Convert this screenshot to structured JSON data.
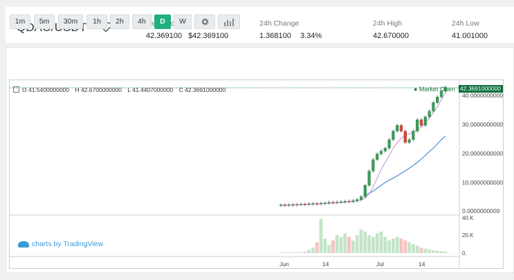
{
  "header": {
    "pair": "QDAO/USDT",
    "last_price_label": "Last Price",
    "last_price": "42.369100",
    "last_price_usd": "$42.369100",
    "change_label": "24h Change",
    "change_value": "1.368100",
    "change_pct": "3.34%",
    "high_label": "24h High",
    "high_value": "42.670000",
    "low_label": "24h Low",
    "low_value": "41.001000"
  },
  "toolbar": {
    "intervals": [
      "1m",
      "5m",
      "30m",
      "1h",
      "2h",
      "4h",
      "D",
      "W"
    ],
    "active": "D",
    "settings_icon": "gear-icon",
    "indicators_icon": "bar-chart-icon"
  },
  "legend": {
    "o": "O  41.5400000000",
    "h": "H  42.6700000000",
    "l": "L  41.4407000000",
    "c": "C  42.3691000000"
  },
  "market_open": "Market Open",
  "price_tag": "42.3691000000",
  "branding": "charts by TradingView",
  "chart_data": {
    "type": "candlestick",
    "price_axis": {
      "ticks": [
        "40.0000000000",
        "30.0000000000",
        "20.0000000000",
        "10.0000000000",
        "0.0000000000"
      ],
      "range": [
        0,
        43
      ]
    },
    "volume_axis": {
      "ticks": [
        "40.K",
        "20.K",
        "0."
      ],
      "range": [
        0,
        40000
      ]
    },
    "x_ticks": [
      "Jun",
      "14",
      "Jul",
      "14"
    ],
    "candles": [
      {
        "o": 1.0,
        "c": 1.1
      },
      {
        "o": 1.1,
        "c": 1.0
      },
      {
        "o": 1.0,
        "c": 1.2
      },
      {
        "o": 1.2,
        "c": 1.1
      },
      {
        "o": 1.1,
        "c": 1.3
      },
      {
        "o": 1.3,
        "c": 1.4
      },
      {
        "o": 1.4,
        "c": 1.3
      },
      {
        "o": 1.3,
        "c": 1.5
      },
      {
        "o": 1.5,
        "c": 1.6
      },
      {
        "o": 1.6,
        "c": 1.5
      },
      {
        "o": 1.5,
        "c": 1.7
      },
      {
        "o": 1.7,
        "c": 1.8
      },
      {
        "o": 1.8,
        "c": 2.0
      },
      {
        "o": 2.0,
        "c": 1.9
      },
      {
        "o": 1.9,
        "c": 2.1
      },
      {
        "o": 2.1,
        "c": 2.2
      },
      {
        "o": 2.2,
        "c": 2.4
      },
      {
        "o": 2.4,
        "c": 2.3
      },
      {
        "o": 2.3,
        "c": 2.6
      },
      {
        "o": 2.6,
        "c": 3.0
      },
      {
        "o": 3.0,
        "c": 4.0
      },
      {
        "o": 4.0,
        "c": 8.0
      },
      {
        "o": 8.0,
        "c": 13.0
      },
      {
        "o": 13.0,
        "c": 17.0
      },
      {
        "o": 17.0,
        "c": 19.0
      },
      {
        "o": 19.0,
        "c": 20.0
      },
      {
        "o": 20.0,
        "c": 21.0
      },
      {
        "o": 21.0,
        "c": 24.0
      },
      {
        "o": 24.0,
        "c": 27.0
      },
      {
        "o": 27.0,
        "c": 29.0
      },
      {
        "o": 29.0,
        "c": 27.0
      },
      {
        "o": 27.0,
        "c": 23.0
      },
      {
        "o": 23.0,
        "c": 24.0
      },
      {
        "o": 24.0,
        "c": 27.0
      },
      {
        "o": 27.0,
        "c": 31.0
      },
      {
        "o": 31.0,
        "c": 29.0
      },
      {
        "o": 29.0,
        "c": 32.0
      },
      {
        "o": 32.0,
        "c": 34.0
      },
      {
        "o": 34.0,
        "c": 37.0
      },
      {
        "o": 37.0,
        "c": 39.0
      },
      {
        "o": 39.0,
        "c": 41.0
      },
      {
        "o": 41.0,
        "c": 42.4
      }
    ],
    "ma_short": [
      1.0,
      1.05,
      1.1,
      1.15,
      1.2,
      1.25,
      1.3,
      1.35,
      1.4,
      1.45,
      1.5,
      1.6,
      1.7,
      1.8,
      1.9,
      2.0,
      2.1,
      2.2,
      2.3,
      2.5,
      2.8,
      3.5,
      5.0,
      7.5,
      10.5,
      13.5,
      16.0,
      18.5,
      21.0,
      23.0,
      24.5,
      25.5,
      26.0,
      26.5,
      27.5,
      28.5,
      30.0,
      31.5,
      33.5,
      35.5,
      38.0,
      40.5
    ],
    "ma_long_start": 21,
    "ma_long": [
      4.5,
      5.2,
      6.0,
      7.0,
      8.0,
      9.0,
      9.8,
      10.5,
      11.3,
      12.2,
      13.0,
      14.0,
      15.0,
      16.0,
      17.2,
      18.5,
      19.8,
      21.0,
      22.5,
      24.0,
      25.2
    ],
    "volume": [
      800,
      900,
      700,
      1000,
      900,
      1100,
      1200,
      3500,
      6000,
      12000,
      38000,
      16000,
      9000,
      14000,
      20000,
      18000,
      22000,
      18000,
      14000,
      20000,
      26000,
      24000,
      20000,
      18000,
      22000,
      24000,
      18000,
      14000,
      16000,
      18000,
      16000,
      14000,
      12000,
      10000,
      8000,
      6000,
      5000,
      4000,
      3000,
      2500,
      2000,
      1500
    ]
  }
}
